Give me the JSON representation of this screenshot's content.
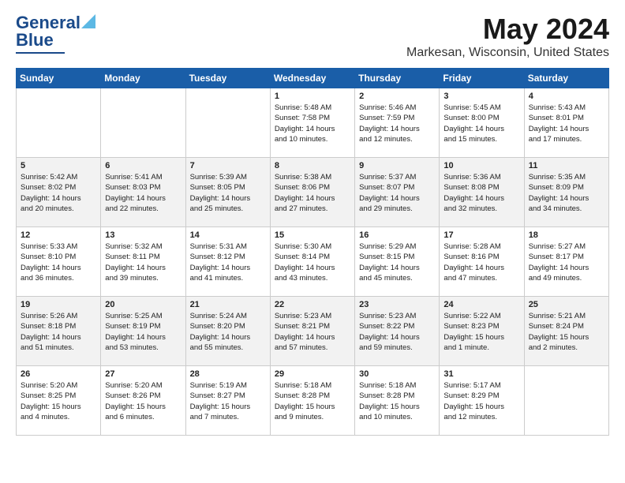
{
  "header": {
    "logo_general": "General",
    "logo_blue": "Blue",
    "main_title": "May 2024",
    "subtitle": "Markesan, Wisconsin, United States"
  },
  "weekdays": [
    "Sunday",
    "Monday",
    "Tuesday",
    "Wednesday",
    "Thursday",
    "Friday",
    "Saturday"
  ],
  "weeks": [
    [
      {
        "day": "",
        "info": ""
      },
      {
        "day": "",
        "info": ""
      },
      {
        "day": "",
        "info": ""
      },
      {
        "day": "1",
        "info": "Sunrise: 5:48 AM\nSunset: 7:58 PM\nDaylight: 14 hours\nand 10 minutes."
      },
      {
        "day": "2",
        "info": "Sunrise: 5:46 AM\nSunset: 7:59 PM\nDaylight: 14 hours\nand 12 minutes."
      },
      {
        "day": "3",
        "info": "Sunrise: 5:45 AM\nSunset: 8:00 PM\nDaylight: 14 hours\nand 15 minutes."
      },
      {
        "day": "4",
        "info": "Sunrise: 5:43 AM\nSunset: 8:01 PM\nDaylight: 14 hours\nand 17 minutes."
      }
    ],
    [
      {
        "day": "5",
        "info": "Sunrise: 5:42 AM\nSunset: 8:02 PM\nDaylight: 14 hours\nand 20 minutes."
      },
      {
        "day": "6",
        "info": "Sunrise: 5:41 AM\nSunset: 8:03 PM\nDaylight: 14 hours\nand 22 minutes."
      },
      {
        "day": "7",
        "info": "Sunrise: 5:39 AM\nSunset: 8:05 PM\nDaylight: 14 hours\nand 25 minutes."
      },
      {
        "day": "8",
        "info": "Sunrise: 5:38 AM\nSunset: 8:06 PM\nDaylight: 14 hours\nand 27 minutes."
      },
      {
        "day": "9",
        "info": "Sunrise: 5:37 AM\nSunset: 8:07 PM\nDaylight: 14 hours\nand 29 minutes."
      },
      {
        "day": "10",
        "info": "Sunrise: 5:36 AM\nSunset: 8:08 PM\nDaylight: 14 hours\nand 32 minutes."
      },
      {
        "day": "11",
        "info": "Sunrise: 5:35 AM\nSunset: 8:09 PM\nDaylight: 14 hours\nand 34 minutes."
      }
    ],
    [
      {
        "day": "12",
        "info": "Sunrise: 5:33 AM\nSunset: 8:10 PM\nDaylight: 14 hours\nand 36 minutes."
      },
      {
        "day": "13",
        "info": "Sunrise: 5:32 AM\nSunset: 8:11 PM\nDaylight: 14 hours\nand 39 minutes."
      },
      {
        "day": "14",
        "info": "Sunrise: 5:31 AM\nSunset: 8:12 PM\nDaylight: 14 hours\nand 41 minutes."
      },
      {
        "day": "15",
        "info": "Sunrise: 5:30 AM\nSunset: 8:14 PM\nDaylight: 14 hours\nand 43 minutes."
      },
      {
        "day": "16",
        "info": "Sunrise: 5:29 AM\nSunset: 8:15 PM\nDaylight: 14 hours\nand 45 minutes."
      },
      {
        "day": "17",
        "info": "Sunrise: 5:28 AM\nSunset: 8:16 PM\nDaylight: 14 hours\nand 47 minutes."
      },
      {
        "day": "18",
        "info": "Sunrise: 5:27 AM\nSunset: 8:17 PM\nDaylight: 14 hours\nand 49 minutes."
      }
    ],
    [
      {
        "day": "19",
        "info": "Sunrise: 5:26 AM\nSunset: 8:18 PM\nDaylight: 14 hours\nand 51 minutes."
      },
      {
        "day": "20",
        "info": "Sunrise: 5:25 AM\nSunset: 8:19 PM\nDaylight: 14 hours\nand 53 minutes."
      },
      {
        "day": "21",
        "info": "Sunrise: 5:24 AM\nSunset: 8:20 PM\nDaylight: 14 hours\nand 55 minutes."
      },
      {
        "day": "22",
        "info": "Sunrise: 5:23 AM\nSunset: 8:21 PM\nDaylight: 14 hours\nand 57 minutes."
      },
      {
        "day": "23",
        "info": "Sunrise: 5:23 AM\nSunset: 8:22 PM\nDaylight: 14 hours\nand 59 minutes."
      },
      {
        "day": "24",
        "info": "Sunrise: 5:22 AM\nSunset: 8:23 PM\nDaylight: 15 hours\nand 1 minute."
      },
      {
        "day": "25",
        "info": "Sunrise: 5:21 AM\nSunset: 8:24 PM\nDaylight: 15 hours\nand 2 minutes."
      }
    ],
    [
      {
        "day": "26",
        "info": "Sunrise: 5:20 AM\nSunset: 8:25 PM\nDaylight: 15 hours\nand 4 minutes."
      },
      {
        "day": "27",
        "info": "Sunrise: 5:20 AM\nSunset: 8:26 PM\nDaylight: 15 hours\nand 6 minutes."
      },
      {
        "day": "28",
        "info": "Sunrise: 5:19 AM\nSunset: 8:27 PM\nDaylight: 15 hours\nand 7 minutes."
      },
      {
        "day": "29",
        "info": "Sunrise: 5:18 AM\nSunset: 8:28 PM\nDaylight: 15 hours\nand 9 minutes."
      },
      {
        "day": "30",
        "info": "Sunrise: 5:18 AM\nSunset: 8:28 PM\nDaylight: 15 hours\nand 10 minutes."
      },
      {
        "day": "31",
        "info": "Sunrise: 5:17 AM\nSunset: 8:29 PM\nDaylight: 15 hours\nand 12 minutes."
      },
      {
        "day": "",
        "info": ""
      }
    ]
  ]
}
